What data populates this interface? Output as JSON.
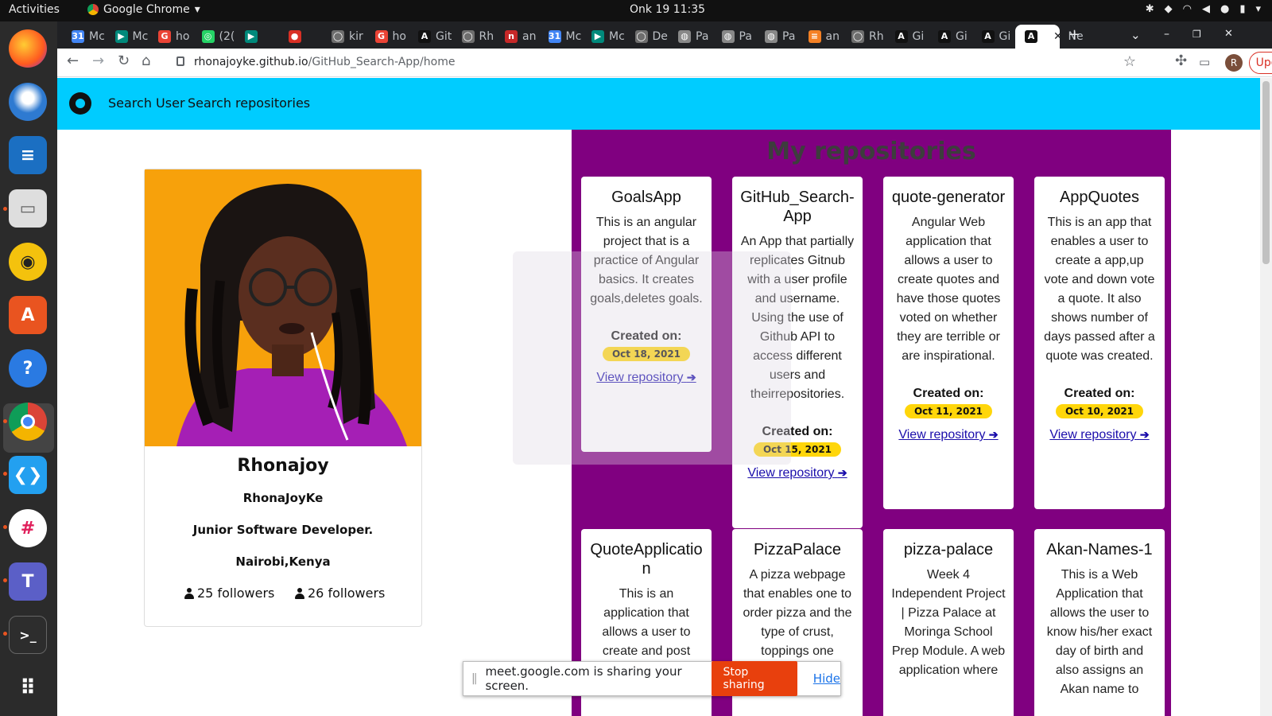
{
  "system_bar": {
    "activities": "Activities",
    "app_name": "Google Chrome",
    "datetime": "Onk 19  11:35"
  },
  "dock": {
    "apps": [
      "firefox-icon",
      "thunderbird-icon",
      "writer-icon",
      "files-icon",
      "rhythmbox-icon",
      "software-icon",
      "help-icon",
      "chrome-icon",
      "vscode-icon",
      "slack-icon",
      "teams-icon",
      "terminal-icon",
      "app-grid-icon"
    ]
  },
  "tabs": [
    {
      "label": "Mc",
      "icon": "calendar-icon"
    },
    {
      "label": "Mc",
      "icon": "meet-icon"
    },
    {
      "label": "ho",
      "icon": "google-icon"
    },
    {
      "label": "(2(",
      "icon": "whatsapp-icon"
    },
    {
      "label": "",
      "icon": "meet-icon"
    },
    {
      "label": "",
      "icon": "record-icon"
    },
    {
      "label": "kir",
      "icon": "github-icon"
    },
    {
      "label": "ho",
      "icon": "google-icon"
    },
    {
      "label": "Git",
      "icon": "angular-icon"
    },
    {
      "label": "Rh",
      "icon": "github-icon"
    },
    {
      "label": "an",
      "icon": "app-icon"
    },
    {
      "label": "Mc",
      "icon": "calendar-icon"
    },
    {
      "label": "Mc",
      "icon": "meet-icon"
    },
    {
      "label": "De",
      "icon": "github-icon"
    },
    {
      "label": "Pa",
      "icon": "globe-icon"
    },
    {
      "label": "Pa",
      "icon": "globe-icon"
    },
    {
      "label": "Pa",
      "icon": "globe-icon"
    },
    {
      "label": "an",
      "icon": "stackoverflow-icon"
    },
    {
      "label": "Rh",
      "icon": "github-icon"
    },
    {
      "label": "Gi",
      "icon": "angular-icon"
    },
    {
      "label": "Gi",
      "icon": "angular-icon"
    },
    {
      "label": "Gi",
      "icon": "angular-icon"
    },
    {
      "label": "",
      "icon": "angular-icon",
      "active": true
    },
    {
      "label": "Ne",
      "icon": ""
    }
  ],
  "omnibox": {
    "host": "rhonajoyke.github.io",
    "path": "/GitHub_Search-App/home"
  },
  "toolbar": {
    "avatar_letter": "R",
    "update_label": "Update"
  },
  "navbar": {
    "search_user": "Search User",
    "search_repos": "Search repositories"
  },
  "profile": {
    "name": "Rhonajoy",
    "login": "RhonaJoyKe",
    "bio": "Junior Software Developer.",
    "location": "Nairobi,Kenya",
    "followers_text": "25 followers",
    "following_text": "26 followers"
  },
  "repos_title": "My repositories",
  "repos": [
    {
      "name": "GoalsApp",
      "description": "This is an angular project that is a practice of Angular basics. It creates goals,deletes goals.",
      "created_label": "Created on:",
      "date": "Oct 18, 2021",
      "link": "View repository"
    },
    {
      "name": "GitHub_Search-App",
      "description": "An App that partially replicates Gitnub with a user profile and username. Using the use of Github API to access different users and theirrepositories.",
      "created_label": "Created on:",
      "date": "Oct 15, 2021",
      "link": "View repository"
    },
    {
      "name": "quote-generator",
      "description": "Angular Web application that allows a user to create quotes and have those quotes voted on whether they are terrible or are inspirational.",
      "created_label": "Created on:",
      "date": "Oct 11, 2021",
      "link": "View repository"
    },
    {
      "name": "AppQuotes",
      "description": "This is an app that enables a user to create a app,up vote and down vote a quote. It also shows number of days passed after a quote was created.",
      "created_label": "Created on:",
      "date": "Oct 10, 2021",
      "link": "View repository"
    },
    {
      "name": "QuoteApplication",
      "description": "This is an application that allows a user to create and post quotes",
      "created_label": "",
      "date": "",
      "link": ""
    },
    {
      "name": "PizzaPalace",
      "description": "A pizza webpage that enables one to order pizza and the type of crust, toppings one",
      "created_label": "",
      "date": "",
      "link": ""
    },
    {
      "name": "pizza-palace",
      "description": "Week 4 Independent Project | Pizza Palace at Moringa School Prep Module. A web application where",
      "created_label": "",
      "date": "",
      "link": ""
    },
    {
      "name": "Akan-Names-1",
      "description": "This is a Web Application that allows the user to know his/her exact day of birth and also assigns an Akan name to",
      "created_label": "",
      "date": "",
      "link": ""
    }
  ],
  "share_bar": {
    "message": "meet.google.com is sharing your screen.",
    "stop_label": "Stop sharing",
    "hide_label": "Hide"
  },
  "colors": {
    "navbar": "#00ccff",
    "repos_panel": "#800080",
    "profile_photo_bg": "#f7a10b",
    "date_badge": "#ffd60a",
    "stop_button": "#e8400d"
  }
}
